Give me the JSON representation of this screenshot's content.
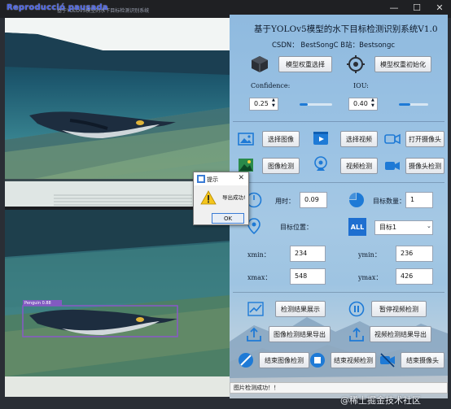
{
  "window": {
    "overlay_label": "Reproducció pausada",
    "title": "基于YOLOv5模型的水下目标检测识别系统",
    "minimize_glyph": "—",
    "maximize_glyph": "☐",
    "close_glyph": "✕"
  },
  "panel": {
    "title": "基于YOLOv5模型的水下目标检测识别系统V1.0",
    "credits": "CSDN： BestSongC   B站：Bestsongc",
    "buttons": {
      "select_weights": "模型权重选择",
      "init_weights": "模型权重初始化",
      "select_image": "选择图像",
      "select_video": "选择视频",
      "open_camera": "打开摄像头",
      "detect_image": "图像检测",
      "detect_video": "视频检测",
      "detect_camera": "摄像头检测",
      "show_results": "检测结果展示",
      "pause_video": "暂停视频检测",
      "export_image": "图像检测结果导出",
      "export_video": "视频检测结果导出",
      "end_image": "结束图像检测",
      "end_video": "结束视频检测",
      "end_camera": "结束摄像头"
    },
    "confidence": {
      "label": "Confidence:",
      "value": "0.25",
      "level": 0.25
    },
    "iou": {
      "label": "IOU:",
      "value": "0.40",
      "level": 0.4
    },
    "time": {
      "label": "用时：",
      "value": "0.09"
    },
    "target_count": {
      "label": "目标数量：",
      "value": "1"
    },
    "target_position": {
      "label": "目标位置：",
      "selected": "目标1"
    },
    "coords": {
      "xmin_label": "xmin：",
      "xmin": "234",
      "ymin_label": "ymin：",
      "ymin": "236",
      "xmax_label": "xmax：",
      "xmax": "548",
      "ymax_label": "ymax：",
      "ymax": "426"
    }
  },
  "detection": {
    "label": "Penguin 0.88"
  },
  "dialog": {
    "title": "提示",
    "message": "导出成功!",
    "ok": "OK",
    "close_glyph": "✕"
  },
  "status": {
    "text": "图片检测成功！！"
  },
  "watermark": "@稀土掘金技术社区",
  "colors": {
    "button_face": "#eef0f3",
    "accent_blue": "#1e7ad6",
    "detection_box": "#8a58c8"
  }
}
